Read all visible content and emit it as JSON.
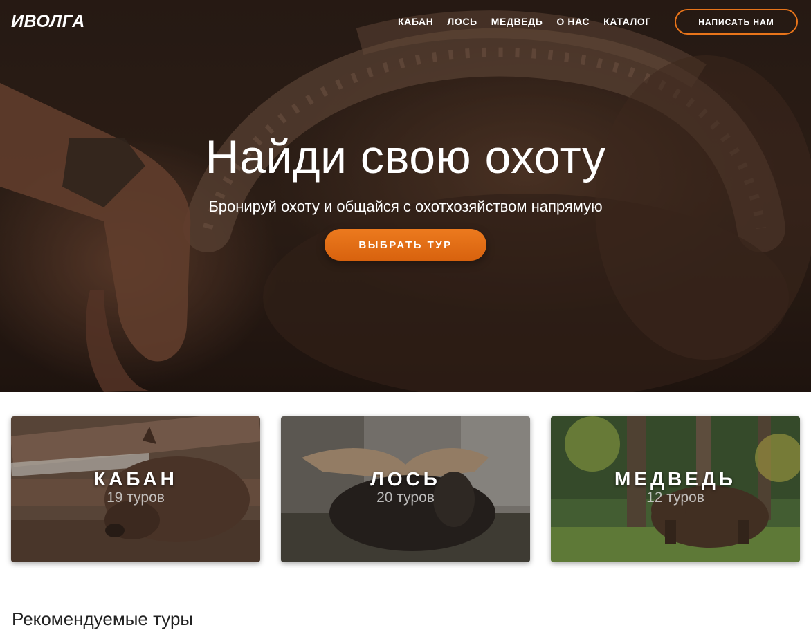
{
  "header": {
    "logo": "ИВОЛГА",
    "nav": [
      "КАБАН",
      "ЛОСЬ",
      "МЕДВЕДЬ",
      "О НАС",
      "КАТАЛОГ"
    ],
    "contact_button": "НАПИСАТЬ НАМ"
  },
  "hero": {
    "title": "Найди свою охоту",
    "subtitle": "Бронируй охоту и общайся с охотхозяйством напрямую",
    "cta": "ВЫБРАТЬ ТУР"
  },
  "categories": [
    {
      "title": "КАБАН",
      "count": "19 туров",
      "image": "boar-photo"
    },
    {
      "title": "ЛОСЬ",
      "count": "20 туров",
      "image": "moose-photo"
    },
    {
      "title": "МЕДВЕДЬ",
      "count": "12 туров",
      "image": "bear-photo"
    }
  ],
  "recommended": {
    "title": "Рекомендуемые туры"
  },
  "colors": {
    "accent": "#e8741a",
    "hero_dark": "#2c1e17",
    "text": "#222222"
  }
}
